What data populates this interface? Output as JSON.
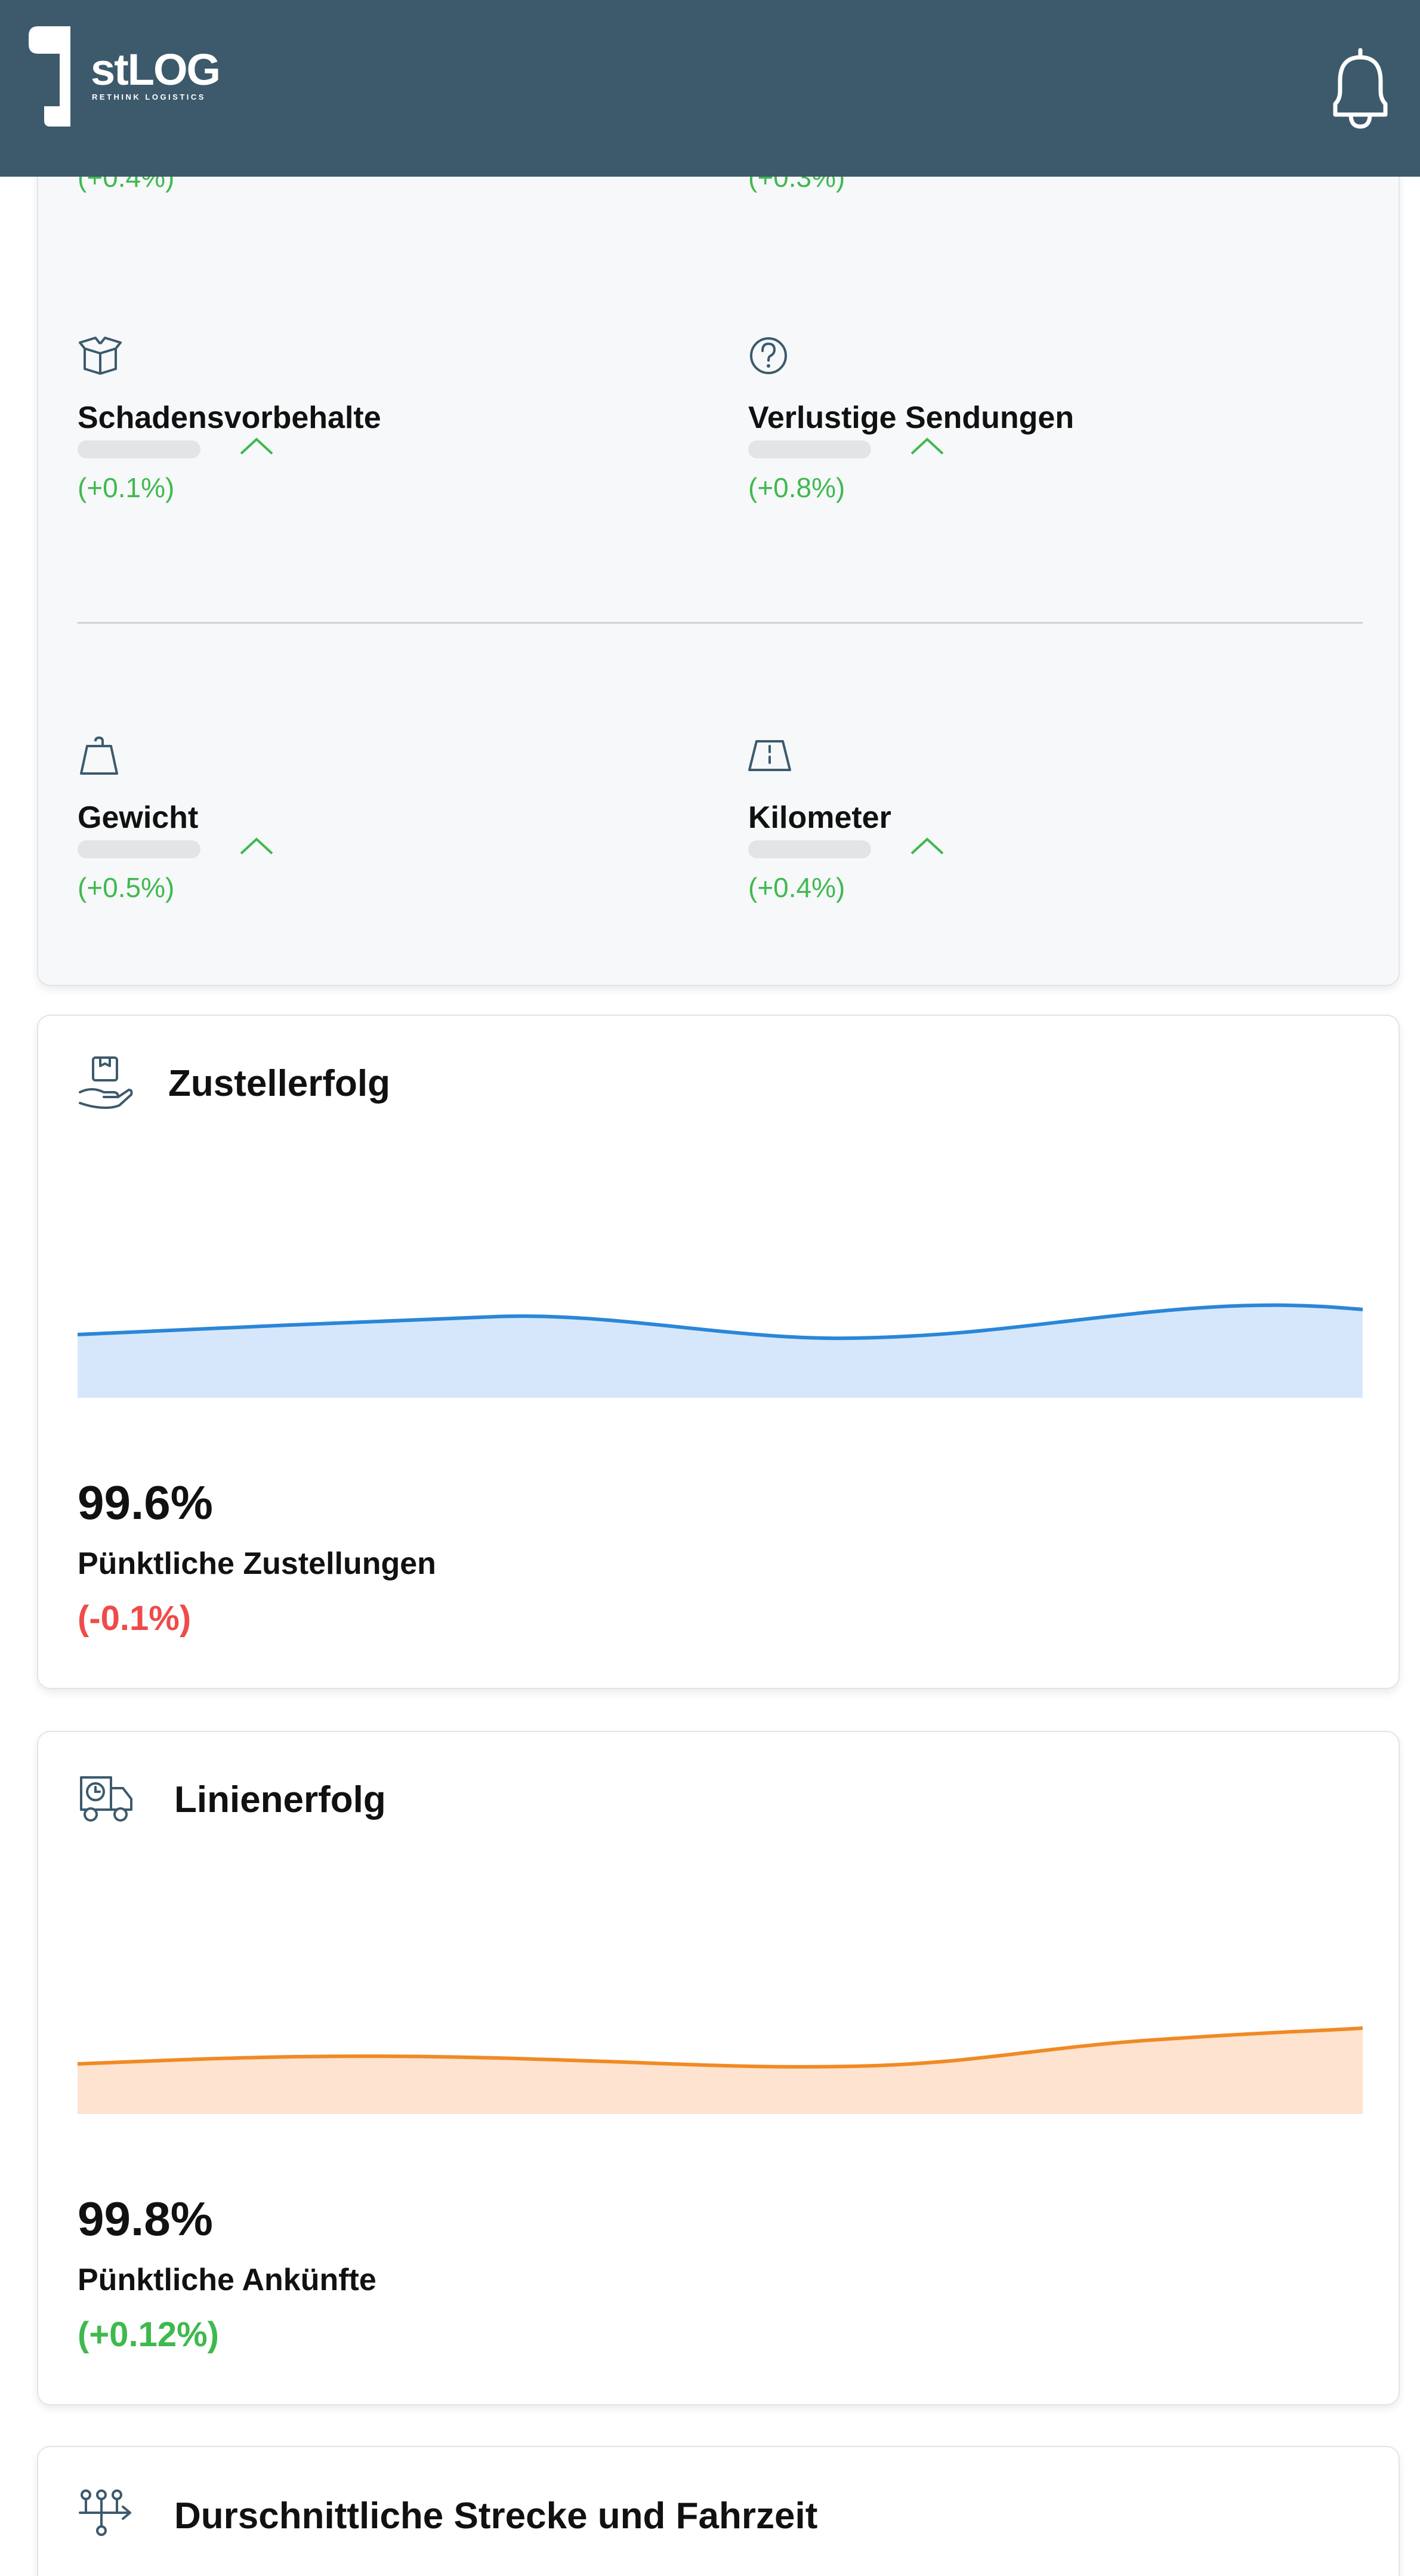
{
  "header": {
    "logo_text": "stLOG",
    "logo_tagline": "RETHINK LOGISTICS",
    "bg_color": "#3c5a6c",
    "notification_icon": "bell-icon"
  },
  "metrics": {
    "top_row": [
      {
        "change": "(+0.4%)"
      },
      {
        "change": "(+0.3%)"
      }
    ],
    "items": [
      {
        "icon": "open-box-icon",
        "label": "Schadensvorbehalte",
        "change": "(+0.1%)"
      },
      {
        "icon": "question-circle-icon",
        "label": "Verlustige Sendungen",
        "change": "(+0.8%)"
      },
      {
        "icon": "weight-icon",
        "label": "Gewicht",
        "change": "(+0.5%)"
      },
      {
        "icon": "road-icon",
        "label": "Kilometer",
        "change": "(+0.4%)"
      }
    ],
    "positive_color": "#3fb94e"
  },
  "delivery": {
    "icon": "hand-package-icon",
    "title": "Zustellerfolg",
    "value": "99.6%",
    "subtitle": "Pünktliche Zustellungen",
    "change": "(-0.1%)",
    "change_color": "#ee4b4b",
    "line_color": "#2a86d8",
    "fill_color": "#d6e7fb"
  },
  "line_success": {
    "icon": "truck-clock-icon",
    "title": "Linienerfolg",
    "value": "99.8%",
    "subtitle": "Pünktliche Ankünfte",
    "change": "(+0.12%)",
    "change_color": "#3fb94e",
    "line_color": "#f08a24",
    "fill_color": "#fde3d0"
  },
  "route": {
    "icon": "route-split-icon",
    "title": "Durschnittliche Strecke und Fahrzeit"
  }
}
